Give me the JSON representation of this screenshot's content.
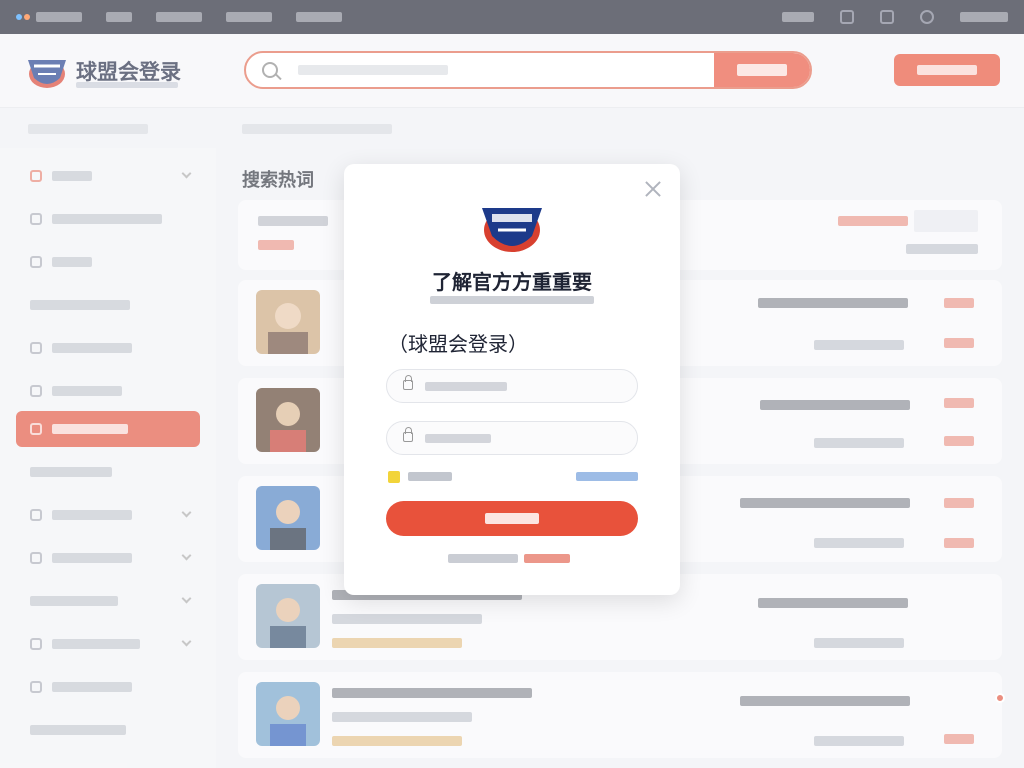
{
  "brand": {
    "name": "球盟会登录"
  },
  "topbar": {
    "dot_colors": [
      "#3aa0ff",
      "#ff7a2e"
    ]
  },
  "search": {
    "placeholder": "",
    "button_label": ""
  },
  "main": {
    "section_title": "搜索热词"
  },
  "login_modal": {
    "title": "了解官方方重重要",
    "heading": "（球盟会登录）",
    "username_placeholder": "",
    "password_placeholder": "",
    "remember_checked": true,
    "login_label": ""
  },
  "colors": {
    "accent": "#e8523b",
    "topbar": "#1e2130",
    "link": "#5b8fd6",
    "checkbox": "#f2d43a"
  },
  "icons": [
    "search-icon",
    "lock-icon",
    "close-icon",
    "chevron-down-icon",
    "logo-icon"
  ]
}
